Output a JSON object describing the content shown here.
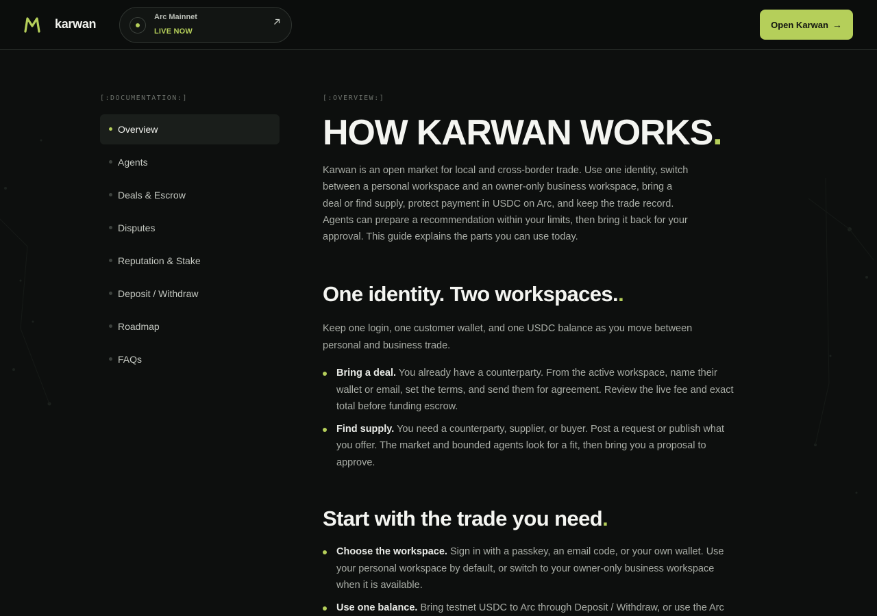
{
  "header": {
    "brand": "karwan",
    "network": {
      "name": "Arc Mainnet",
      "status": "LIVE NOW"
    },
    "cta_label": "Open Karwan",
    "cta_arrow": "→"
  },
  "sidebar": {
    "label": "[:DOCUMENTATION:]",
    "items": [
      {
        "label": "Overview",
        "active": true
      },
      {
        "label": "Agents"
      },
      {
        "label": "Deals & Escrow"
      },
      {
        "label": "Disputes"
      },
      {
        "label": "Reputation & Stake"
      },
      {
        "label": "Deposit / Withdraw"
      },
      {
        "label": "Roadmap"
      },
      {
        "label": "FAQs"
      }
    ]
  },
  "main": {
    "label": "[:OVERVIEW:]",
    "title": "HOW KARWAN WORKS",
    "title_dot": ".",
    "intro": "Karwan is an open market for local and cross-border trade. Use one identity, switch between a personal workspace and an owner-only business workspace, bring a deal or find supply, protect payment in USDC on Arc, and keep the trade record. Agents can prepare a recommendation within your limits, then bring it back for your approval. This guide explains the parts you can use today.",
    "section1": {
      "heading": "One identity. Two workspaces.",
      "heading_dot": ".",
      "body": "Keep one login, one customer wallet, and one USDC balance as you move between personal and business trade.",
      "bullets": [
        {
          "lead": "Bring a deal.",
          "text": " You already have a counterparty. From the active workspace, name their wallet or email, set the terms, and send them for agreement. Review the live fee and exact total before funding escrow."
        },
        {
          "lead": "Find supply.",
          "text": " You need a counterparty, supplier, or buyer. Post a request or publish what you offer. The market and bounded agents look for a fit, then bring you a proposal to approve."
        }
      ]
    },
    "section2": {
      "heading": "Start with the trade you need",
      "heading_dot": ".",
      "bullets": [
        {
          "lead": "Choose the workspace.",
          "text": " Sign in with a passkey, an email code, or your own wallet. Use your personal workspace by default, or switch to your owner-only business workspace when it is available."
        },
        {
          "lead": "Use one balance.",
          "text": " Bring testnet USDC to Arc through Deposit / Withdraw, or use the Arc faucet while testing. Personal and business workspaces share the customer"
        }
      ]
    }
  },
  "colors": {
    "accent": "#b5cf5a",
    "background": "#0d0f0e",
    "text": "#e8eae6",
    "muted": "#a9ada6"
  }
}
